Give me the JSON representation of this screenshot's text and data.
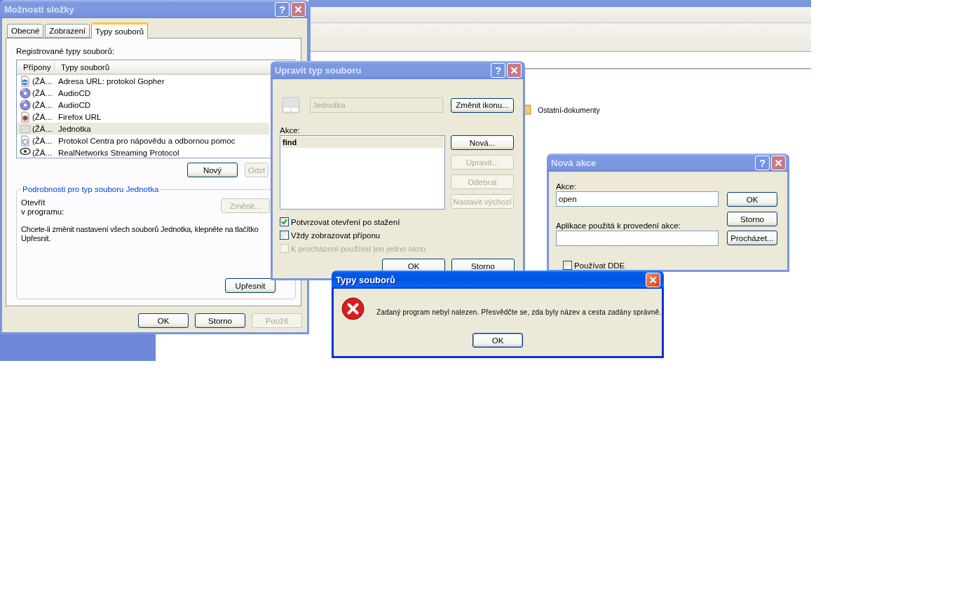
{
  "background_window": {
    "folder_label": "Ostatní-dokumenty"
  },
  "folder_options": {
    "title": "Možnosti složky",
    "active": false,
    "help": "?",
    "tabs": [
      {
        "label": "Obecné",
        "selected": false
      },
      {
        "label": "Zobrazení",
        "selected": false
      },
      {
        "label": "Typy souborů",
        "selected": true
      }
    ],
    "list_label": "Registrované typy souborů:",
    "columns": [
      "Přípony",
      "Typy souborů"
    ],
    "rows": [
      {
        "kind": "web",
        "extension": "(ŽÁ...",
        "type": "Adresa URL: protokol Gopher",
        "selected": false
      },
      {
        "kind": "cd",
        "extension": "(ŽÁ...",
        "type": "AudioCD",
        "selected": false
      },
      {
        "kind": "cd",
        "extension": "(ŽÁ...",
        "type": "AudioCD",
        "selected": false
      },
      {
        "kind": "firefox",
        "extension": "(ŽÁ...",
        "type": "Firefox URL",
        "selected": false
      },
      {
        "kind": "drive",
        "extension": "(ŽÁ...",
        "type": "Jednotka",
        "selected": true
      },
      {
        "kind": "help",
        "extension": "(ŽÁ...",
        "type": "Protokol Centra pro nápovědu a odbornou pomoc",
        "selected": false
      },
      {
        "kind": "stream",
        "extension": "(ŽÁ...",
        "type": "RealNetworks Streaming Protocol",
        "selected": false
      }
    ],
    "list_buttons": [
      {
        "label": "Nový",
        "disabled": false
      },
      {
        "label": "Odst",
        "disabled": true
      }
    ],
    "details": {
      "title": "Podrobnosti pro typ souboru Jednotka",
      "open_with_label": "Otevřít\nv programu:",
      "change_button": {
        "label": "Změnit...",
        "disabled": true
      },
      "note": "Chcete-li změnit nastavení všech souborů Jednotka, klepněte na tlačítko Upřesnit.",
      "advanced_button": {
        "label": "Upřesnit",
        "disabled": false
      }
    },
    "buttons": [
      {
        "label": "OK",
        "disabled": false
      },
      {
        "label": "Storno",
        "disabled": false
      },
      {
        "label": "Použít",
        "disabled": true
      }
    ]
  },
  "edit_file_type": {
    "title": "Upravit typ souboru",
    "active": false,
    "help": "?",
    "description": {
      "value": "Jednotka",
      "disabled": true
    },
    "change_icon_button": "Změnit ikonu...",
    "actions_label": "Akce:",
    "actions": [
      {
        "label": "find",
        "selected": true
      }
    ],
    "action_buttons": [
      {
        "label": "Nová...",
        "disabled": false
      },
      {
        "label": "Upravit...",
        "disabled": true
      },
      {
        "label": "Odebrat",
        "disabled": true
      },
      {
        "label": "Nastavit výchozí",
        "disabled": true
      }
    ],
    "options": [
      {
        "label": "Potvrzovat otevření po stažení",
        "checked": true,
        "disabled": false
      },
      {
        "label": "Vždy zobrazovat příponu",
        "checked": false,
        "disabled": false
      },
      {
        "label": "K procházení používat jen jedno okno",
        "checked": false,
        "disabled": true
      }
    ],
    "buttons": [
      {
        "label": "OK",
        "disabled": false
      },
      {
        "label": "Storno",
        "disabled": false
      }
    ]
  },
  "new_action": {
    "title": "Nová akce",
    "active": false,
    "help": "?",
    "action_label": "Akce:",
    "action_value": "open",
    "application_label": "Aplikace použitá k provedení akce:",
    "buttons": [
      {
        "label": "OK",
        "disabled": false
      },
      {
        "label": "Storno",
        "disabled": false
      },
      {
        "label": "Procházet...",
        "disabled": false
      }
    ],
    "use_dde": {
      "label": "Používat DDE",
      "checked": false
    }
  },
  "error_dialog": {
    "title": "Typy souborů",
    "active": true,
    "message": "Zadaný program nebyl nalezen. Přesvědčte se, zda byly název a cesta zadány správně.",
    "button": "OK"
  }
}
